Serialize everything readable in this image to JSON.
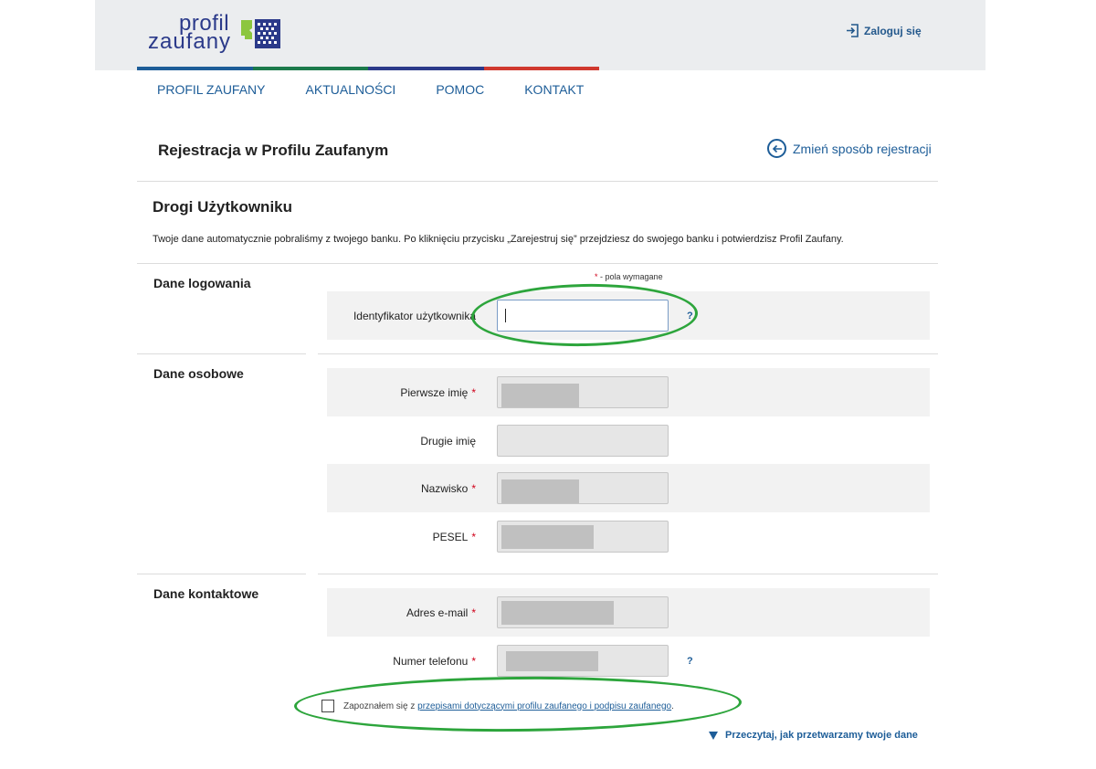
{
  "header": {
    "logo_line1": "profil",
    "logo_line2": "zaufany",
    "login_label": "Zaloguj się",
    "stripe_colors": [
      "#1d5d98",
      "#1b7a4b",
      "#2b3a8a",
      "#d0392f"
    ]
  },
  "nav": {
    "items": [
      "PROFIL ZAUFANY",
      "AKTUALNOŚCI",
      "POMOC",
      "KONTAKT"
    ]
  },
  "page": {
    "title": "Rejestracja w Profilu Zaufanym",
    "change_way_label": "Zmień sposób rejestracji",
    "greeting": "Drogi Użytkowniku",
    "info": "Twoje dane automatycznie pobraliśmy z twojego banku. Po kliknięciu przycisku „Zarejestruj się” przejdziesz do swojego banku i potwierdzisz Profil Zaufany.",
    "required_note": "- pola wymagane",
    "required_star": "*"
  },
  "sections": {
    "login": {
      "title": "Dane logowania",
      "fields": [
        {
          "label": "Identyfikator użytkownika",
          "required": false,
          "value": "",
          "help": "?"
        }
      ]
    },
    "personal": {
      "title": "Dane osobowe",
      "fields": [
        {
          "label": "Pierwsze imię",
          "required": true,
          "redacted": true
        },
        {
          "label": "Drugie imię",
          "required": false,
          "redacted": false
        },
        {
          "label": "Nazwisko",
          "required": true,
          "redacted": true
        },
        {
          "label": "PESEL",
          "required": true,
          "redacted": true
        }
      ]
    },
    "contact": {
      "title": "Dane kontaktowe",
      "fields": [
        {
          "label": "Adres e-mail",
          "required": true,
          "redacted": true
        },
        {
          "label": "Numer telefonu",
          "required": true,
          "redacted": true,
          "help": "?"
        }
      ]
    }
  },
  "consent": {
    "prefix": "Zapoznałem się z ",
    "link": "przepisami dotyczącymi profilu zaufanego i podpisu zaufanego",
    "suffix": ".",
    "checked": false
  },
  "read_more_label": "Przeczytaj, jak przetwarzamy twoje dane",
  "annotation_color": "#2da53c"
}
